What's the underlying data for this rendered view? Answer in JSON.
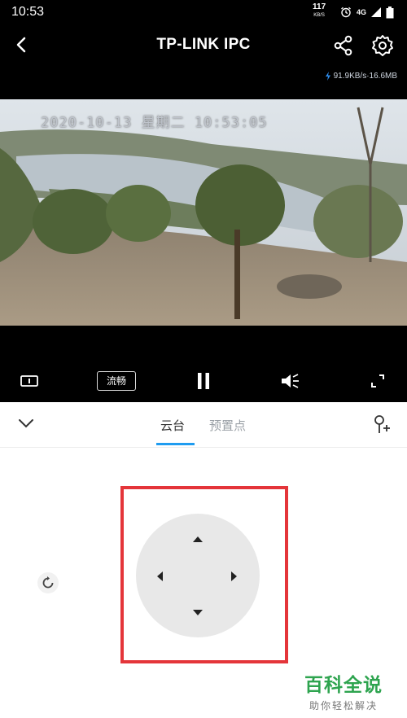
{
  "status": {
    "time": "10:53",
    "net_speed": "117",
    "net_unit": "KB/S",
    "signal": "4G"
  },
  "header": {
    "title": "TP-LINK IPC",
    "back_icon": "back-arrow-icon",
    "share_icon": "share-icon",
    "settings_icon": "gear-icon"
  },
  "stream": {
    "stats": "91.9KB/s·16.6MB",
    "osd_timestamp": "2020-10-13 星期二 10:53:05"
  },
  "controls": {
    "quality_label": "流畅",
    "pause_icon": "pause-icon",
    "volume_icon": "speaker-icon",
    "fullscreen_icon": "fullscreen-icon",
    "info_icon": "screen-info-icon"
  },
  "tabs": [
    {
      "label": "云台",
      "active": true
    },
    {
      "label": "预置点",
      "active": false
    }
  ],
  "colors": {
    "accent": "#1f9cf0",
    "highlight": "#e4353a",
    "watermark": "#2ea44f"
  },
  "watermark": {
    "main": "百科全说",
    "sub": "助你轻松解决"
  }
}
